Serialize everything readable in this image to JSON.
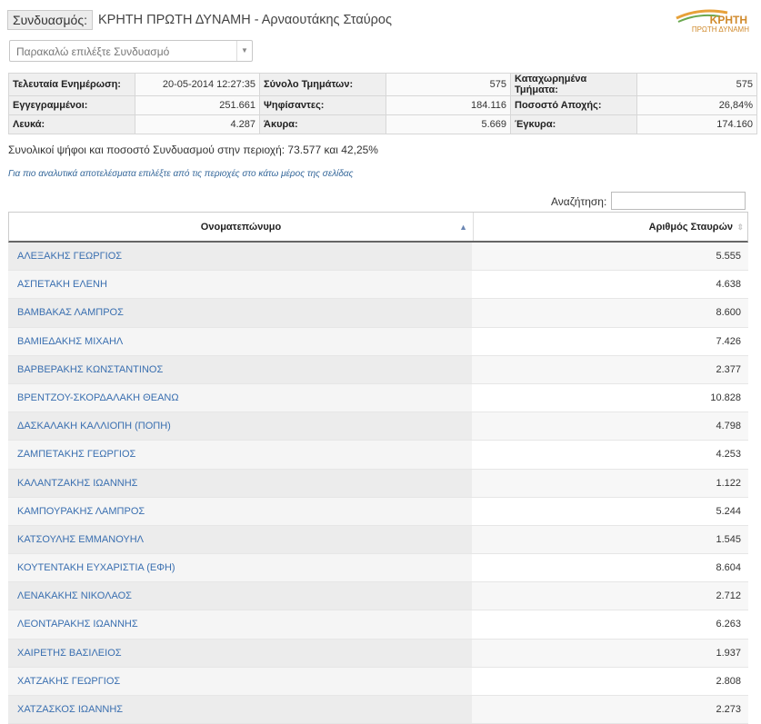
{
  "header": {
    "label": "Συνδυασμός:",
    "title": "ΚΡΗΤΗ ΠΡΩΤΗ ΔΥΝΑΜΗ - Αρναουτάκης Σταύρος",
    "logo_word": "ΚΡΗΤΗ",
    "logo_sub": "ΠΡΩΤΗ ΔΥΝΑΜΗ"
  },
  "select": {
    "placeholder": "Παρακαλώ επιλέξτε Συνδυασμό"
  },
  "stats": {
    "rows": [
      {
        "l1": "Τελευταία Ενημέρωση:",
        "v1": "20-05-2014 12:27:35",
        "l2": "Σύνολο Τμημάτων:",
        "v2": "575",
        "l3": "Καταχωρημένα Τμήματα:",
        "v3": "575"
      },
      {
        "l1": "Εγγεγραμμένοι:",
        "v1": "251.661",
        "l2": "Ψηφίσαντες:",
        "v2": "184.116",
        "l3": "Ποσοστό Αποχής:",
        "v3": "26,84%"
      },
      {
        "l1": "Λευκά:",
        "v1": "4.287",
        "l2": "Άκυρα:",
        "v2": "5.669",
        "l3": "Έγκυρα:",
        "v3": "174.160"
      }
    ]
  },
  "summary": "Συνολικοί ψήφοι και ποσοστό Συνδυασμού στην περιοχή: 73.577 και 42,25%",
  "hint": "Για πιο αναλυτικά αποτελέσματα επιλέξτε από τις περιοχές στο κάτω μέρος της σελίδας",
  "search": {
    "label": "Αναζήτηση:",
    "value": ""
  },
  "grid": {
    "col_name": "Ονοματεπώνυμο",
    "col_votes": "Αριθμός Σταυρών",
    "rows": [
      {
        "name": "ΑΛΕΞΑΚΗΣ ΓΕΩΡΓΙΟΣ",
        "votes": "5.555"
      },
      {
        "name": "ΑΣΠΕΤΑΚΗ ΕΛΕΝΗ",
        "votes": "4.638"
      },
      {
        "name": "ΒΑΜΒΑΚΑΣ ΛΑΜΠΡΟΣ",
        "votes": "8.600"
      },
      {
        "name": "ΒΑΜΙΕΔΑΚΗΣ ΜΙΧΑΗΛ",
        "votes": "7.426"
      },
      {
        "name": "ΒΑΡΒΕΡΑΚΗΣ ΚΩΝΣΤΑΝΤΙΝΟΣ",
        "votes": "2.377"
      },
      {
        "name": "ΒΡΕΝΤΖΟΥ-ΣΚΟΡΔΑΛΑΚΗ ΘΕΑΝΩ",
        "votes": "10.828"
      },
      {
        "name": "ΔΑΣΚΑΛΑΚΗ ΚΑΛΛΙΟΠΗ (ΠΟΠΗ)",
        "votes": "4.798"
      },
      {
        "name": "ΖΑΜΠΕΤΑΚΗΣ ΓΕΩΡΓΙΟΣ",
        "votes": "4.253"
      },
      {
        "name": "ΚΑΛΑΝΤΖΑΚΗΣ ΙΩΑΝΝΗΣ",
        "votes": "1.122"
      },
      {
        "name": "ΚΑΜΠΟΥΡΑΚΗΣ ΛΑΜΠΡΟΣ",
        "votes": "5.244"
      },
      {
        "name": "ΚΑΤΣΟΥΛΗΣ ΕΜΜΑΝΟΥΗΛ",
        "votes": "1.545"
      },
      {
        "name": "ΚΟΥΤΕΝΤΑΚΗ ΕΥΧΑΡΙΣΤΙΑ (ΕΦΗ)",
        "votes": "8.604"
      },
      {
        "name": "ΛΕΝΑΚΑΚΗΣ ΝΙΚΟΛΑΟΣ",
        "votes": "2.712"
      },
      {
        "name": "ΛΕΟΝΤΑΡΑΚΗΣ ΙΩΑΝΝΗΣ",
        "votes": "6.263"
      },
      {
        "name": "ΧΑΙΡΕΤΗΣ ΒΑΣΙΛΕΙΟΣ",
        "votes": "1.937"
      },
      {
        "name": "ΧΑΤΖΑΚΗΣ ΓΕΩΡΓΙΟΣ",
        "votes": "2.808"
      },
      {
        "name": "ΧΑΤΖΑΣΚΟΣ ΙΩΑΝΝΗΣ",
        "votes": "2.273"
      }
    ]
  }
}
